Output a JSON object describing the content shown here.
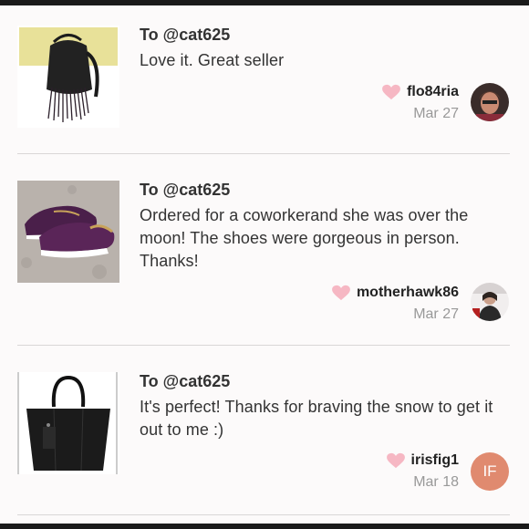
{
  "reviews": [
    {
      "to": "To @cat625",
      "text": "Love it. Great seller",
      "username": "flo84ria",
      "date": "Mar 27",
      "product_icon": "backpack",
      "avatar": "photo"
    },
    {
      "to": "To @cat625",
      "text": "Ordered for a coworkerand she was over the moon! The shoes were gorgeous in person. Thanks!",
      "username": "motherhawk86",
      "date": "Mar 27",
      "product_icon": "sneakers",
      "avatar": "photo"
    },
    {
      "to": "To @cat625",
      "text": "It's perfect! Thanks for braving the snow to get it out to me :)",
      "username": "irisfig1",
      "date": "Mar 18",
      "product_icon": "tote-bag",
      "avatar_initials": "IF"
    }
  ],
  "colors": {
    "heart": "#f6b7c3",
    "initials_avatar": "#e08a6f",
    "date_text": "#999999"
  }
}
